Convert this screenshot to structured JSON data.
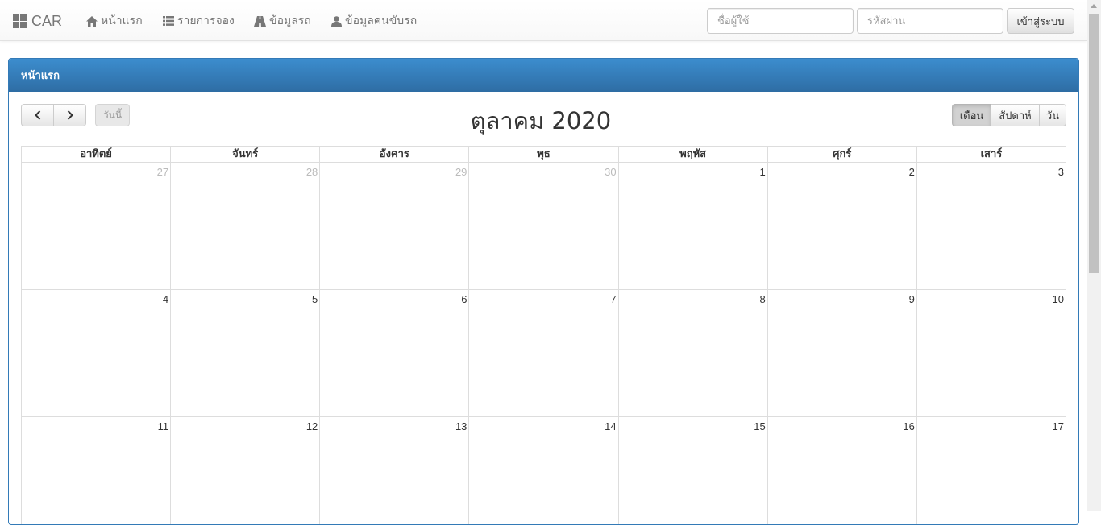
{
  "navbar": {
    "brand": "CAR",
    "items": [
      {
        "label": "หน้าแรก",
        "icon": "home-icon"
      },
      {
        "label": "รายการจอง",
        "icon": "list-icon"
      },
      {
        "label": "ข้อมูลรถ",
        "icon": "road-icon"
      },
      {
        "label": "ข้อมูลคนขับรถ",
        "icon": "user-icon"
      }
    ],
    "username_placeholder": "ชื่อผู้ใช้",
    "password_placeholder": "รหัสผ่าน",
    "login_label": "เข้าสู่ระบบ"
  },
  "panel": {
    "heading": "หน้าแรก"
  },
  "calendar": {
    "title": "ตุลาคม 2020",
    "today_label": "วันนี้",
    "views": {
      "month": "เดือน",
      "week": "สัปดาห์",
      "day": "วัน"
    },
    "active_view": "month",
    "weekdays": [
      "อาทิตย์",
      "จันทร์",
      "อังคาร",
      "พุธ",
      "พฤหัส",
      "ศุกร์",
      "เสาร์"
    ],
    "weeks": [
      [
        {
          "day": "27",
          "other": true
        },
        {
          "day": "28",
          "other": true
        },
        {
          "day": "29",
          "other": true
        },
        {
          "day": "30",
          "other": true
        },
        {
          "day": "1",
          "other": false
        },
        {
          "day": "2",
          "other": false
        },
        {
          "day": "3",
          "other": false
        }
      ],
      [
        {
          "day": "4",
          "other": false
        },
        {
          "day": "5",
          "other": false
        },
        {
          "day": "6",
          "other": false
        },
        {
          "day": "7",
          "other": false
        },
        {
          "day": "8",
          "other": false
        },
        {
          "day": "9",
          "other": false
        },
        {
          "day": "10",
          "other": false
        }
      ],
      [
        {
          "day": "11",
          "other": false
        },
        {
          "day": "12",
          "other": false
        },
        {
          "day": "13",
          "other": false
        },
        {
          "day": "14",
          "other": false
        },
        {
          "day": "15",
          "other": false
        },
        {
          "day": "16",
          "other": false
        },
        {
          "day": "17",
          "other": false
        }
      ]
    ]
  }
}
